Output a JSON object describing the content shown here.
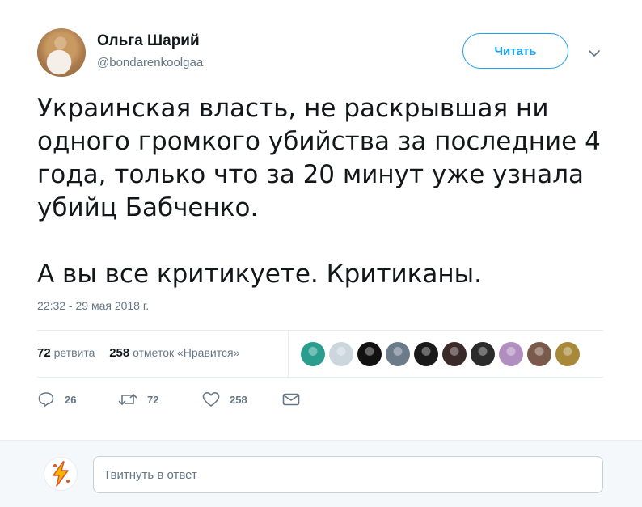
{
  "author": {
    "name": "Ольга Шарий",
    "handle": "@bondarenkoolgaa"
  },
  "follow_button": {
    "label": "Читать"
  },
  "tweet": {
    "text": "Украинская власть, не раскрывшая ни\nодного громкого убийства за последние 4\nгода, только что за 20 минут уже узнала\nубийц Бабченко.\n\nА вы все критикуете. Критиканы.",
    "timestamp": "22:32 - 29 мая 2018 г."
  },
  "stats": {
    "retweets_count": "72",
    "retweets_label": "ретвита",
    "likes_count": "258",
    "likes_label": "отметок «Нравится»"
  },
  "likers": [
    {
      "icon": "liker-avatar-1",
      "color": "#2a9d8f"
    },
    {
      "icon": "liker-avatar-default",
      "color": "#ccd6dd"
    },
    {
      "icon": "liker-avatar-3",
      "color": "#111111"
    },
    {
      "icon": "liker-avatar-4",
      "color": "#6b7b8a"
    },
    {
      "icon": "liker-avatar-5",
      "color": "#1a1a1a"
    },
    {
      "icon": "liker-avatar-6",
      "color": "#3a2a2a"
    },
    {
      "icon": "liker-avatar-7",
      "color": "#2b2b2b"
    },
    {
      "icon": "liker-avatar-8",
      "color": "#b08fc0"
    },
    {
      "icon": "liker-avatar-9",
      "color": "#7a5a4a"
    },
    {
      "icon": "liker-avatar-10",
      "color": "#a8893a"
    }
  ],
  "actions": {
    "reply_count": "26",
    "retweet_count": "72",
    "like_count": "258"
  },
  "reply_box": {
    "placeholder": "Твитнуть в ответ"
  },
  "colors": {
    "accent": "#1da1f2",
    "secondary_text": "#657786",
    "primary_text": "#14171a",
    "divider": "#e6ecf0"
  }
}
